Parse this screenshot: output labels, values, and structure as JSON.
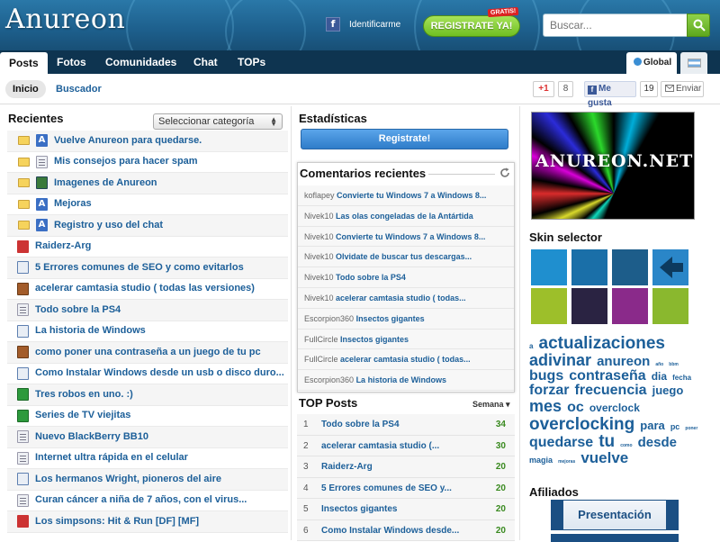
{
  "header": {
    "logo": "Anureon",
    "fb_login": "Identificarme",
    "register": "REGISTRATE YA!",
    "badge": "GRATIS!",
    "search_placeholder": "Buscar..."
  },
  "nav": {
    "tabs": [
      "Posts",
      "Fotos",
      "Comunidades",
      "Chat",
      "TOPs"
    ],
    "global": "Global"
  },
  "subnav": {
    "inicio": "Inicio",
    "buscador": "Buscador",
    "gplus": "+1",
    "gplus_count": "8",
    "fb_like": "Me gusta",
    "fb_count": "19",
    "enviar": "Enviar"
  },
  "recientes": {
    "title": "Recientes",
    "category_select": "Seleccionar categoría",
    "posts": [
      {
        "title": "Vuelve Anureon para quedarse.",
        "icon": "a",
        "folder": true
      },
      {
        "title": "Mis consejos para hacer spam",
        "icon": "doc",
        "folder": true
      },
      {
        "title": "Imagenes de Anureon",
        "icon": "img",
        "folder": true
      },
      {
        "title": "Mejoras",
        "icon": "a",
        "folder": true
      },
      {
        "title": "Registro y uso del chat",
        "icon": "a",
        "folder": true
      },
      {
        "title": "Raiderz-Arg",
        "icon": "game",
        "folder": false
      },
      {
        "title": "5 Errores comunes de SEO y como evitarlos",
        "icon": "book",
        "folder": false
      },
      {
        "title": "acelerar camtasia studio ( todas las versiones)",
        "icon": "phone",
        "folder": false
      },
      {
        "title": "Todo sobre la PS4",
        "icon": "doc",
        "folder": false
      },
      {
        "title": "La historia de Windows",
        "icon": "book",
        "folder": false
      },
      {
        "title": "como poner una contraseña a un juego de tu pc",
        "icon": "phone",
        "folder": false
      },
      {
        "title": "Como Instalar Windows desde un usb o disco duro...",
        "icon": "book",
        "folder": false
      },
      {
        "title": "Tres robos en uno. :)",
        "icon": "film",
        "folder": false
      },
      {
        "title": "Series de TV viejitas",
        "icon": "film",
        "folder": false
      },
      {
        "title": "Nuevo BlackBerry BB10",
        "icon": "doc",
        "folder": false
      },
      {
        "title": "Internet ultra rápida en el celular",
        "icon": "doc",
        "folder": false
      },
      {
        "title": "Los hermanos Wright, pioneros del aire",
        "icon": "book",
        "folder": false
      },
      {
        "title": "Curan cáncer a niña de 7 años, con el virus...",
        "icon": "doc",
        "folder": false
      },
      {
        "title": "Los simpsons: Hit & Run [DF] [MF]",
        "icon": "game",
        "folder": false
      }
    ]
  },
  "estadisticas": {
    "title": "Estadísticas",
    "register": "Registrate!"
  },
  "comentarios": {
    "title": "Comentarios recientes",
    "items": [
      {
        "user": "koflapey",
        "post": "Convierte tu Windows 7 a Windows 8..."
      },
      {
        "user": "Nivek10",
        "post": "Las olas congeladas de la Antártida"
      },
      {
        "user": "Nivek10",
        "post": "Convierte tu Windows 7 a Windows 8..."
      },
      {
        "user": "Nivek10",
        "post": "Olvidate de buscar tus descargas..."
      },
      {
        "user": "Nivek10",
        "post": "Todo sobre la PS4"
      },
      {
        "user": "Nivek10",
        "post": "acelerar camtasia studio ( todas..."
      },
      {
        "user": "Escorpion360",
        "post": "Insectos gigantes"
      },
      {
        "user": "FullCircle",
        "post": "Insectos gigantes"
      },
      {
        "user": "FullCircle",
        "post": "acelerar camtasia studio ( todas..."
      },
      {
        "user": "Escorpion360",
        "post": "La historia de Windows"
      }
    ]
  },
  "top_posts": {
    "title": "TOP Posts",
    "period": "Semana",
    "items": [
      {
        "rank": "1",
        "title": "Todo sobre la PS4",
        "score": "34"
      },
      {
        "rank": "2",
        "title": "acelerar camtasia studio (...",
        "score": "30"
      },
      {
        "rank": "3",
        "title": "Raiderz-Arg",
        "score": "20"
      },
      {
        "rank": "4",
        "title": "5 Errores comunes de SEO y...",
        "score": "20"
      },
      {
        "rank": "5",
        "title": "Insectos gigantes",
        "score": "20"
      },
      {
        "rank": "6",
        "title": "Como Instalar Windows desde...",
        "score": "20"
      }
    ]
  },
  "sidebar": {
    "banner_text": "ANUREON.NET",
    "skin_title": "Skin selector",
    "skins": [
      "#1f8fcf",
      "#1a6fa8",
      "#1d5d8a",
      "#2a86c8",
      "#9dbf2a",
      "#2a2342",
      "#8a2a8a",
      "#8ab82e"
    ],
    "tags": [
      {
        "t": "a",
        "s": 8
      },
      {
        "t": "actualizaciones",
        "s": 19
      },
      {
        "t": "adivinar",
        "s": 18
      },
      {
        "t": "anureon",
        "s": 15
      },
      {
        "t": "año",
        "s": 5
      },
      {
        "t": "bbm",
        "s": 5
      },
      {
        "t": "bugs",
        "s": 16
      },
      {
        "t": "contraseña",
        "s": 16
      },
      {
        "t": "dia",
        "s": 12
      },
      {
        "t": "fecha",
        "s": 8
      },
      {
        "t": "forzar",
        "s": 16
      },
      {
        "t": "frecuencia",
        "s": 16
      },
      {
        "t": "juego",
        "s": 13
      },
      {
        "t": "mes",
        "s": 18
      },
      {
        "t": "oc",
        "s": 16
      },
      {
        "t": "overclock",
        "s": 12
      },
      {
        "t": "overclocking",
        "s": 19
      },
      {
        "t": "para",
        "s": 13
      },
      {
        "t": "pc",
        "s": 9
      },
      {
        "t": "poner",
        "s": 5
      },
      {
        "t": "quedarse",
        "s": 16
      },
      {
        "t": "tu",
        "s": 19
      },
      {
        "t": "como",
        "s": 5
      },
      {
        "t": "desde",
        "s": 15
      },
      {
        "t": "magia",
        "s": 9
      },
      {
        "t": "mejoras",
        "s": 5
      },
      {
        "t": "vuelve",
        "s": 17
      }
    ],
    "afiliados_title": "Afiliados",
    "presentacion": "Presentación"
  }
}
